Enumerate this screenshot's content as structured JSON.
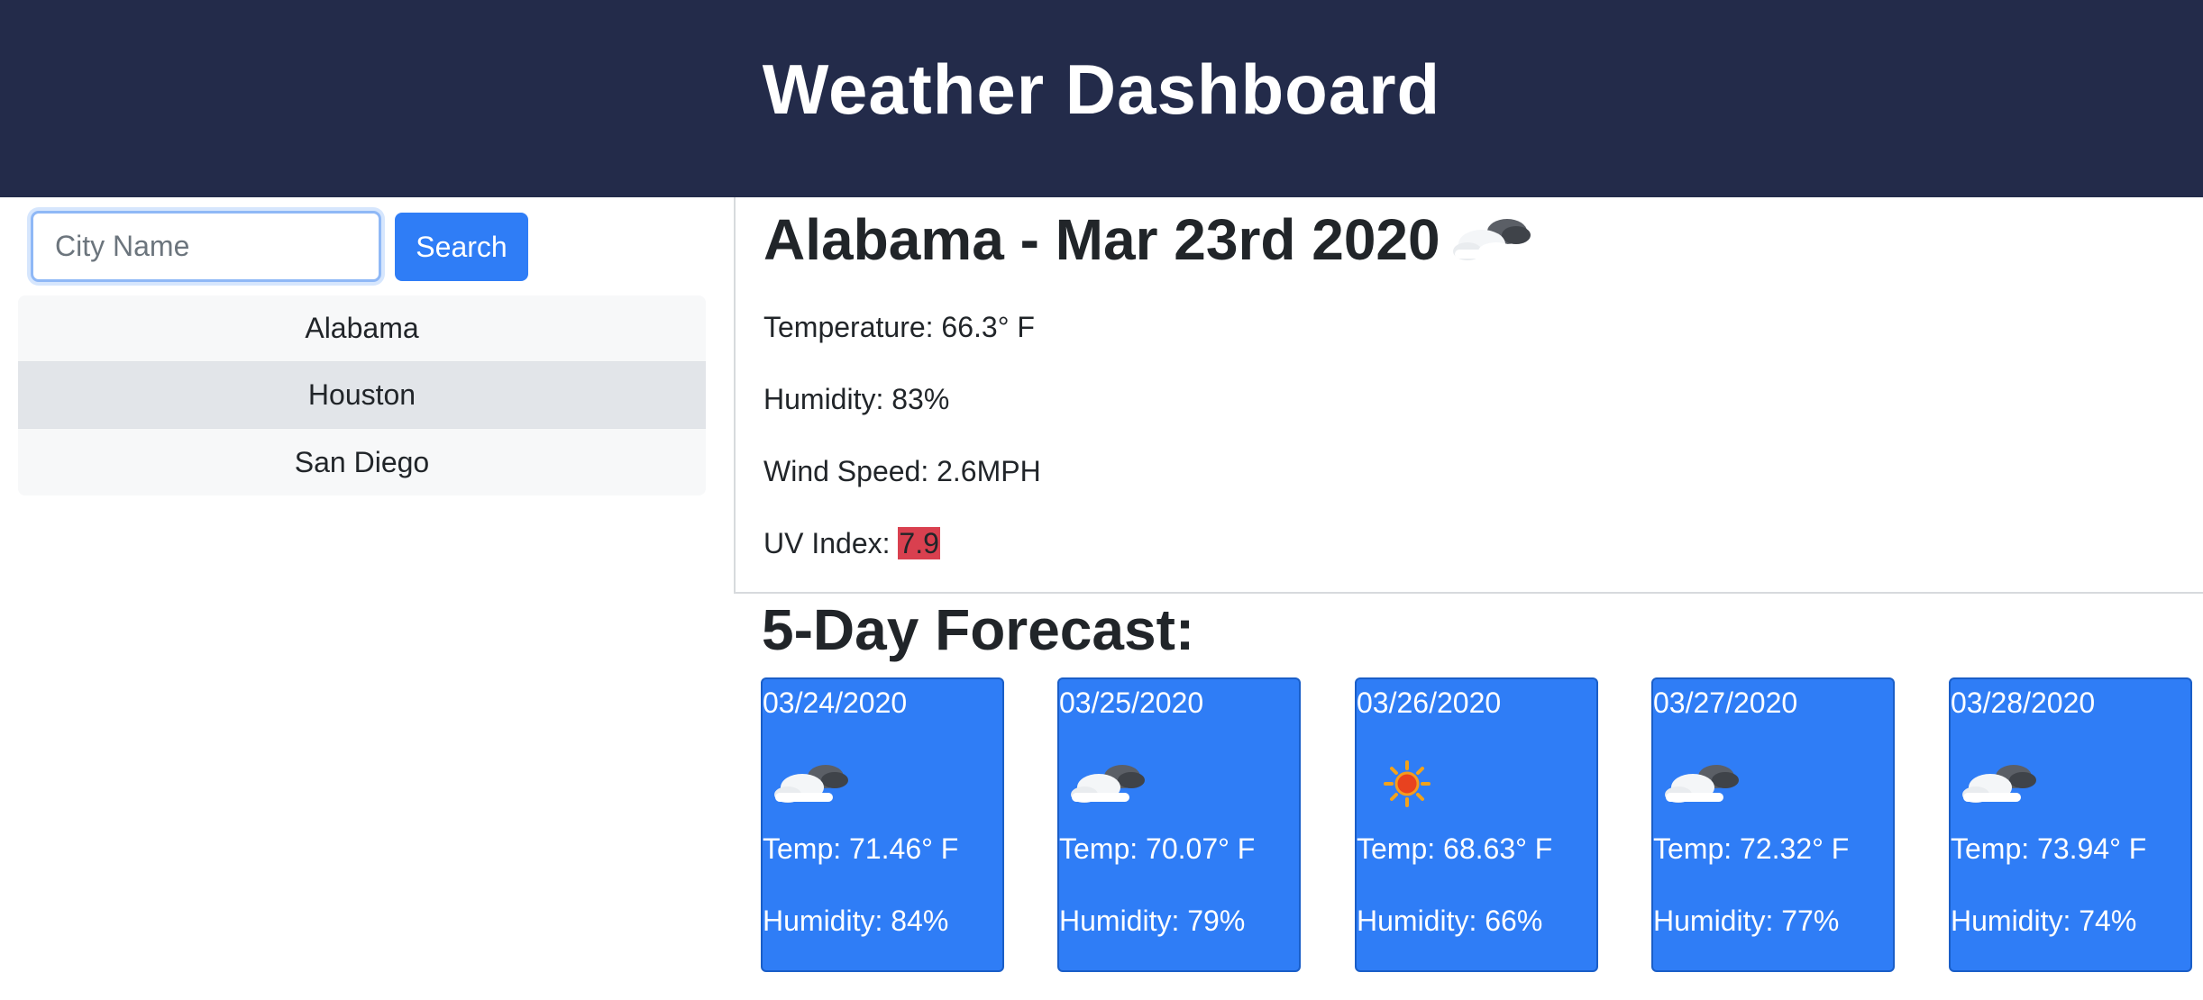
{
  "header": {
    "title": "Weather Dashboard"
  },
  "search": {
    "placeholder": "City Name",
    "value": "",
    "button_label": "Search"
  },
  "sidebar": {
    "cities": [
      {
        "label": "Alabama"
      },
      {
        "label": "Houston",
        "active": true
      },
      {
        "label": "San Diego"
      }
    ]
  },
  "current": {
    "title": "Alabama - Mar 23rd 2020",
    "icon": "cloudy-icon",
    "temperature": "Temperature: 66.3° F",
    "humidity": "Humidity: 83%",
    "wind": "Wind Speed: 2.6MPH",
    "uv_label": "UV Index: ",
    "uv_value": "7.9",
    "uv_color": "#d9404f"
  },
  "forecast": {
    "title": "5-Day Forecast:",
    "accent_color": "#2f7df6",
    "days": [
      {
        "date": "03/24/2020",
        "icon": "cloudy-icon",
        "temp": "Temp: 71.46° F",
        "humidity": "Humidity: 84%"
      },
      {
        "date": "03/25/2020",
        "icon": "cloudy-icon",
        "temp": "Temp: 70.07° F",
        "humidity": "Humidity: 79%"
      },
      {
        "date": "03/26/2020",
        "icon": "sun-icon",
        "temp": "Temp: 68.63° F",
        "humidity": "Humidity: 66%"
      },
      {
        "date": "03/27/2020",
        "icon": "cloudy-icon",
        "temp": "Temp: 72.32° F",
        "humidity": "Humidity: 77%"
      },
      {
        "date": "03/28/2020",
        "icon": "cloudy-icon",
        "temp": "Temp: 73.94° F",
        "humidity": "Humidity: 74%"
      }
    ]
  }
}
